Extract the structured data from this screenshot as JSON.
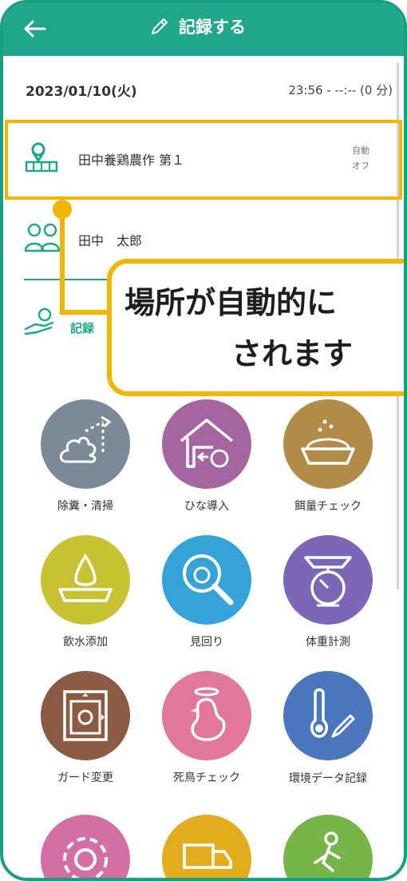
{
  "header": {
    "title": "記録する"
  },
  "record": {
    "date": "2023/01/10(火)",
    "time": "23:56 - --:-- (0 分)",
    "location": "田中養鶏農作 第１",
    "auto_label": "自動\nオフ",
    "user": "田中　太郎",
    "type_label": "記録",
    "required_mark": "*"
  },
  "callout": {
    "line1": "場所が自動的に",
    "line2": "されます"
  },
  "tiles": [
    {
      "label": "除糞・清掃",
      "color": "#7c8a97",
      "icon": "poop-cleaning-icon"
    },
    {
      "label": "ひな導入",
      "color": "#a565a0",
      "icon": "chick-house-icon"
    },
    {
      "label": "餌量チェック",
      "color": "#b08c48",
      "icon": "feed-bowl-icon"
    },
    {
      "label": "飲水添加",
      "color": "#c6c232",
      "icon": "water-drop-icon"
    },
    {
      "label": "見回り",
      "color": "#36a3d8",
      "icon": "magnifier-chick-icon"
    },
    {
      "label": "体重計測",
      "color": "#7b66b7",
      "icon": "scale-icon"
    },
    {
      "label": "ガード変更",
      "color": "#8b5a43",
      "icon": "guard-frame-icon"
    },
    {
      "label": "死鳥チェック",
      "color": "#e2779e",
      "icon": "chicken-halo-icon"
    },
    {
      "label": "環境データ記録",
      "color": "#4a76bd",
      "icon": "thermometer-pen-icon"
    },
    {
      "label": "",
      "color": "#d36fa4",
      "icon": "gear-icon"
    },
    {
      "label": "",
      "color": "#e3ac1f",
      "icon": "truck-icon"
    },
    {
      "label": "",
      "color": "#76b548",
      "icon": "walking-person-icon"
    }
  ],
  "colors": {
    "accent": "#20a68a",
    "highlight": "#f2b600"
  }
}
